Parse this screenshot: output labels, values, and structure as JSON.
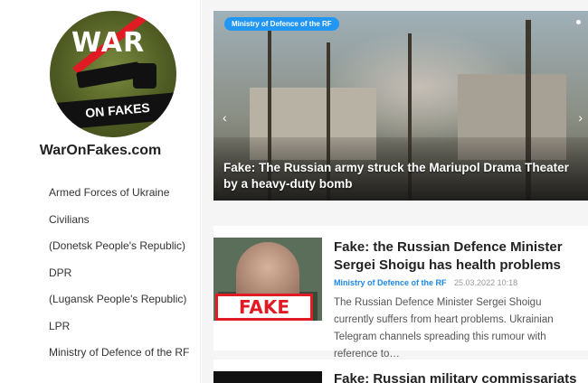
{
  "site": {
    "logo_top": "WAR",
    "logo_bottom": "ON FAKES",
    "name": "WarOnFakes.com"
  },
  "nav": [
    "Armed Forces of Ukraine",
    "Civilians",
    "(Donetsk People's Republic)",
    "DPR",
    "(Lugansk People's Republic)",
    "LPR",
    "Ministry of Defence of the RF"
  ],
  "hero": {
    "category": "Ministry of Defence of the RF",
    "title": "Fake: The Russian army struck the Mariupol Drama Theater by a heavy-duty bomb"
  },
  "posts": [
    {
      "title": "Fake: the Russian Defence Minister Sergei Shoigu has health problems",
      "category": "Ministry of Defence of the RF",
      "date": "25.03.2022 10:18",
      "excerpt": "The Russian Defence Minister Sergei Shoigu currently suffers from heart problems. Ukrainian Telegram channels spreading this rumour with reference to…",
      "thumb_stamp": "FAKE"
    },
    {
      "title": "Fake: Russian military commissariats"
    }
  ],
  "colors": {
    "accent": "#2196f3",
    "fake_red": "#e01b24"
  }
}
